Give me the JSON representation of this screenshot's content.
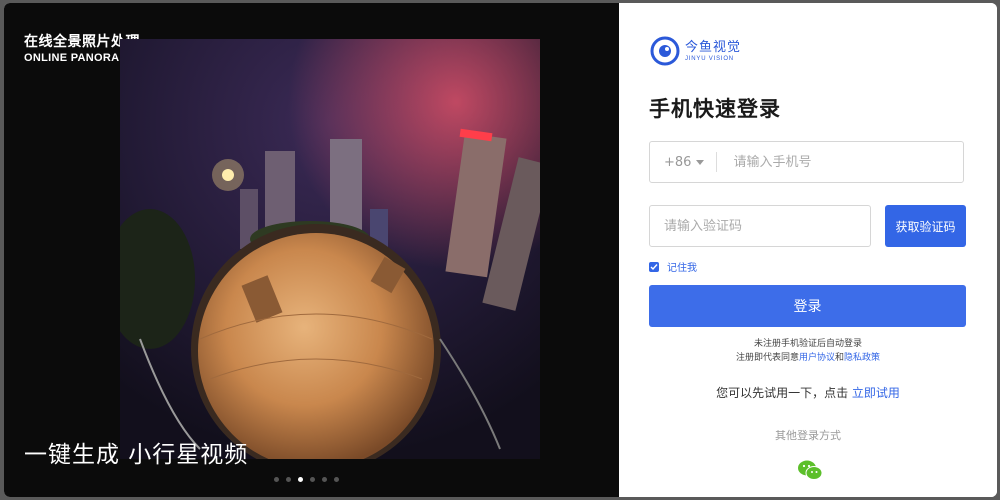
{
  "left": {
    "brand_cn": "在线全景照片处理",
    "brand_en": "ONLINE PANORAMIC PROCESSING",
    "caption": "一键生成 小行星视频",
    "carousel_dots": 6,
    "active_dot": 3
  },
  "right": {
    "logo": {
      "cn": "今鱼视觉",
      "en": "JINYU VISION"
    },
    "title": "手机快速登录",
    "country_code": "+86",
    "phone_placeholder": "请输入手机号",
    "code_placeholder": "请输入验证码",
    "get_code_label": "获取验证码",
    "remember_label": "记住我",
    "login_label": "登录",
    "notice_line1": "未注册手机验证后自动登录",
    "notice_prefix": "注册即代表同意",
    "user_agreement": "用户协议",
    "and_text": "和",
    "privacy_policy": "隐私政策",
    "trial_prefix": "您可以先试用一下，点击",
    "trial_link": "立即试用",
    "other_methods": "其他登录方式"
  },
  "colors": {
    "primary": "#3366e6",
    "dark_panel": "#0b0b0b",
    "wechat": "#5cbf2a"
  },
  "icons": [
    "logo-mark-icon",
    "caret-down-icon",
    "checkmark-icon",
    "wechat-icon"
  ]
}
